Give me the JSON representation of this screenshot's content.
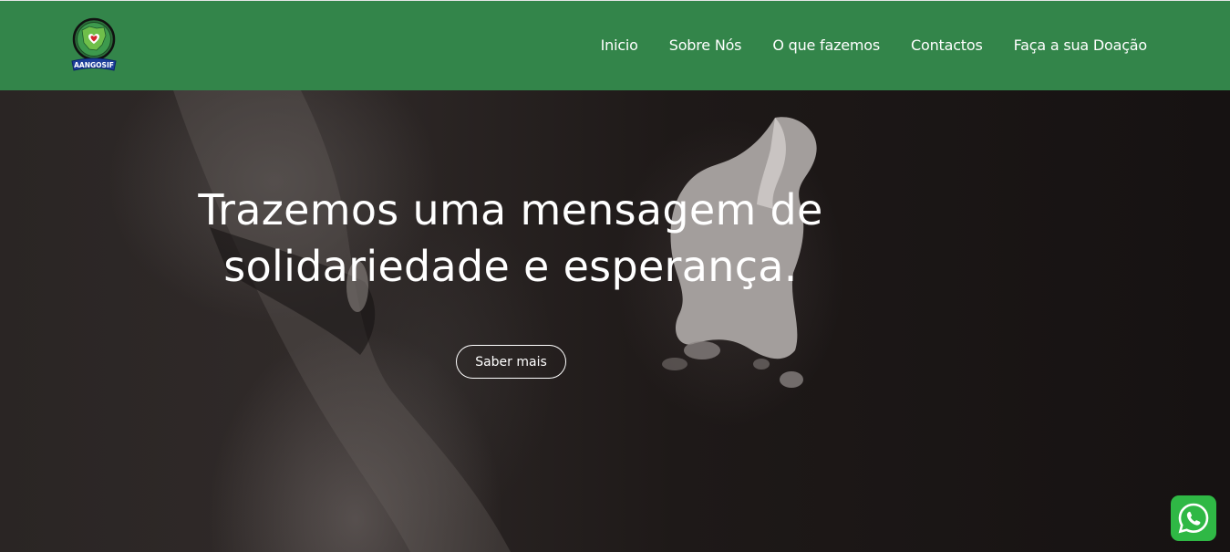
{
  "brand": {
    "logo_text": "AANGOSIF",
    "logo_icon": "heart-map-emblem-icon",
    "primary_color": "#33854a"
  },
  "nav": {
    "items": [
      {
        "label": "Inicio"
      },
      {
        "label": "Sobre Nós"
      },
      {
        "label": "O que fazemos"
      },
      {
        "label": "Contactos"
      },
      {
        "label": "Faça a sua Doação"
      }
    ]
  },
  "hero": {
    "title_line1": "Trazemos uma mensagem de",
    "title_line2": "solidariedade e esperança.",
    "button_label": "Saber mais"
  },
  "floating": {
    "whatsapp_icon": "whatsapp-icon",
    "whatsapp_color": "#2fb845"
  }
}
